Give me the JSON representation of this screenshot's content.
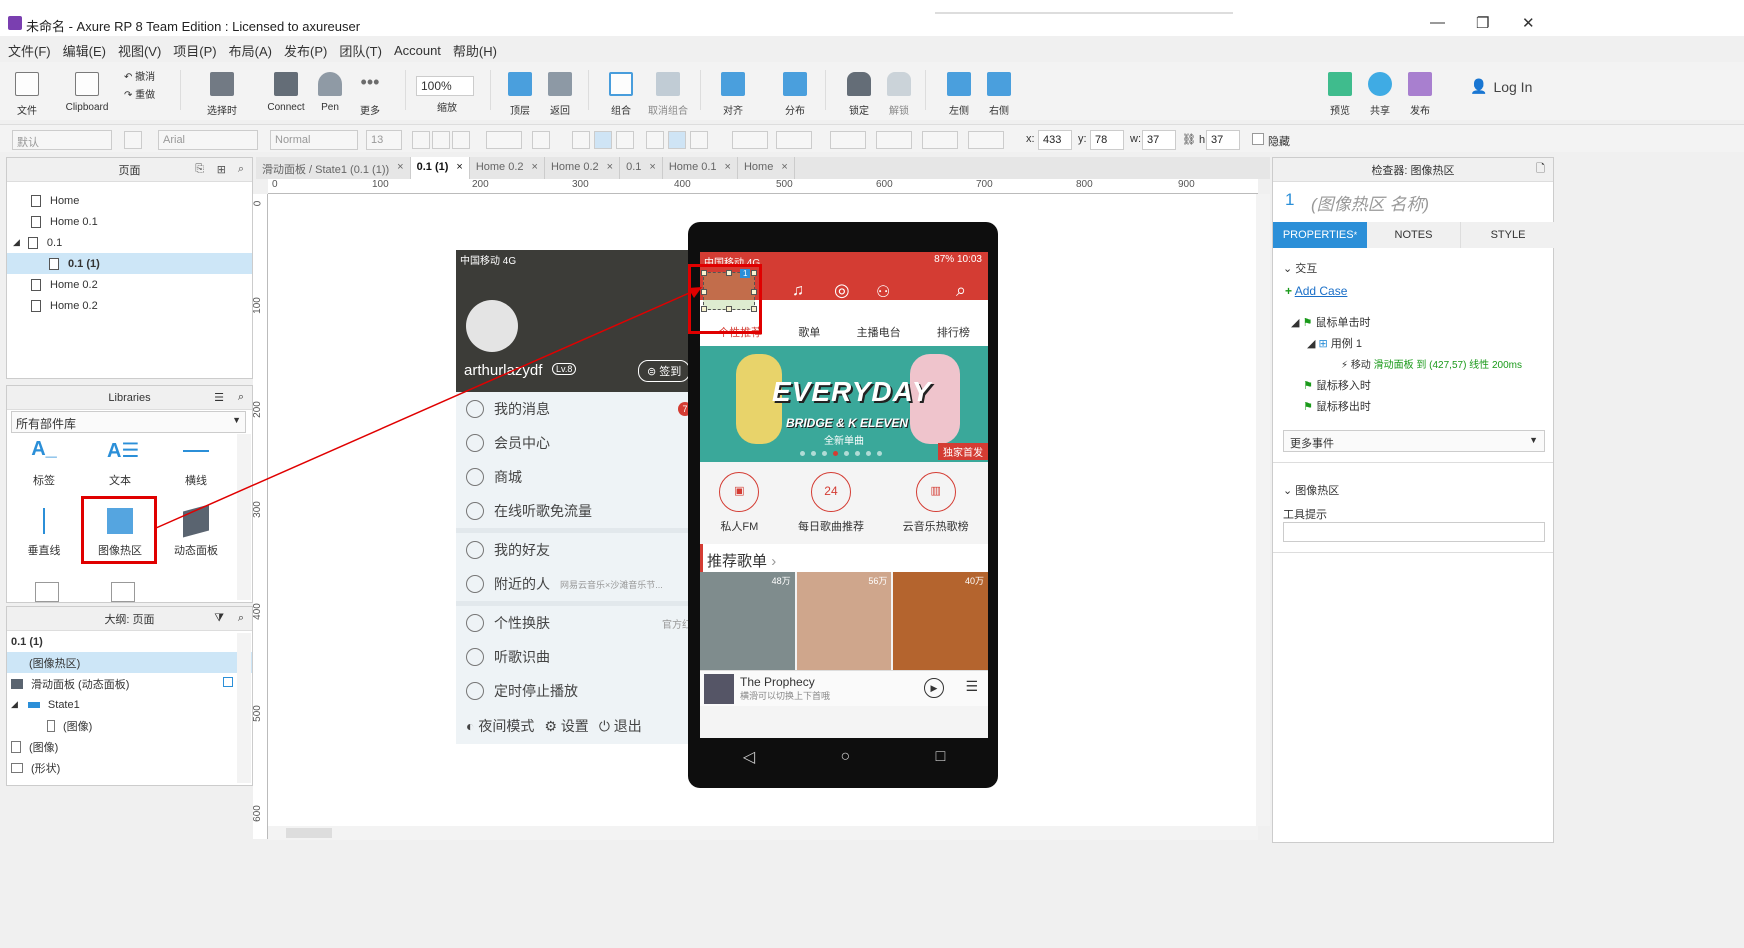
{
  "window": {
    "title": "未命名 - Axure RP 8 Team Edition : Licensed to axureuser",
    "min": "—",
    "max": "❐",
    "close": "✕"
  },
  "menu": [
    "文件(F)",
    "编辑(E)",
    "视图(V)",
    "项目(P)",
    "布局(A)",
    "发布(P)",
    "团队(T)",
    "Account",
    "帮助(H)"
  ],
  "toolbar": {
    "file": "文件",
    "clipboard": "Clipboard",
    "undo": "撤消",
    "redo": "重做",
    "selection": "选择时",
    "connect": "Connect",
    "pen": "Pen",
    "more": "更多",
    "zoom_value": "100%",
    "zoom_label": "缩放",
    "top": "顶层",
    "back": "返回",
    "group": "组合",
    "ungroup": "取消组合",
    "align": "对齐",
    "distribute": "分布",
    "lock": "锁定",
    "unlock": "解锁",
    "left": "左侧",
    "right": "右侧",
    "preview": "预览",
    "share": "共享",
    "publish": "发布",
    "login": "Log In"
  },
  "format": {
    "style": "默认",
    "font": "Arial",
    "weight": "Normal",
    "size": "13",
    "x_label": "x:",
    "x": "433",
    "y_label": "y:",
    "y": "78",
    "w_label": "w:",
    "w": "37",
    "h_label": "h:",
    "h": "37",
    "hidden": "隐藏"
  },
  "pages": {
    "title": "页面",
    "items": [
      "Home",
      "Home 0.1",
      "0.1",
      "0.1 (1)",
      "Home 0.2",
      "Home 0.2"
    ]
  },
  "libraries": {
    "title": "Libraries",
    "select": "所有部件库",
    "items": [
      "标签",
      "文本",
      "横线",
      "垂直线",
      "图像热区",
      "动态面板"
    ]
  },
  "outline": {
    "title": "大纲: 页面",
    "items": [
      "0.1 (1)",
      "(图像热区)",
      "滑动面板 (动态面板)",
      "State1",
      "(图像)",
      "(图像)",
      "(形状)"
    ]
  },
  "tabs": [
    "滑动面板 / State1 (0.1 (1))",
    "0.1 (1)",
    "Home 0.2",
    "Home 0.2",
    "0.1",
    "Home 0.1",
    "Home"
  ],
  "ruler_h": [
    "0",
    "100",
    "200",
    "300",
    "400",
    "500",
    "600",
    "700",
    "800",
    "900"
  ],
  "ruler_v": [
    "0",
    "100",
    "200",
    "300",
    "400",
    "500",
    "600"
  ],
  "inspector": {
    "title": "检查器: 图像热区",
    "num": "1",
    "name_placeholder": "(图像热区 名称)",
    "tabs": [
      "PROPERTIES",
      "NOTES",
      "STYLE"
    ],
    "interaction": "交互",
    "add_case": "Add Case",
    "on_click": "鼠标单击时",
    "case1": "用例 1",
    "move_action": "移动",
    "move_detail": "滑动面板 到 (427,57) 线性 200ms",
    "mouse_enter": "鼠标移入时",
    "mouse_leave": "鼠标移出时",
    "more_events": "更多事件",
    "hotspot": "图像热区",
    "tooltip": "工具提示"
  },
  "drawer": {
    "status": "中国移动 4G",
    "username": "arthurlazydf",
    "level": "Lv.8",
    "checkin": "签到",
    "badge": "7",
    "items": [
      "我的消息",
      "会员中心",
      "商城",
      "在线听歌免流量",
      "我的好友",
      "附近的人",
      "个性换肤",
      "听歌识曲",
      "定时停止播放"
    ],
    "nearby_hint": "网易云音乐×沙滩音乐节...",
    "skin_hint": "官方红",
    "bottom": [
      "夜间模式",
      "设置",
      "退出"
    ]
  },
  "phone": {
    "status_left": "中国移动 4G",
    "status_right": "87% 10:03",
    "hotspot_badge": "1",
    "tabs": [
      "个性推荐",
      "歌单",
      "主播电台",
      "排行榜"
    ],
    "banner_title": "EVERYDAY",
    "banner_sub": "BRIDGE & K ELEVEN",
    "banner_sub2": "全新单曲",
    "banner_tag": "独家首发",
    "quick": [
      {
        "label": "私人FM"
      },
      {
        "label": "每日歌曲推荐",
        "num": "24"
      },
      {
        "label": "云音乐热歌榜"
      }
    ],
    "section": "推荐歌单",
    "playlist_counts": [
      "48万",
      "56万",
      "40万"
    ],
    "now_playing": "The Prophecy",
    "now_playing_sub": "横滑可以切换上下首哦"
  },
  "colors": {
    "accent": "#0ea5e8",
    "netease_red": "#d43c33",
    "highlight": "#e00000",
    "green": "#2a8a2a"
  }
}
